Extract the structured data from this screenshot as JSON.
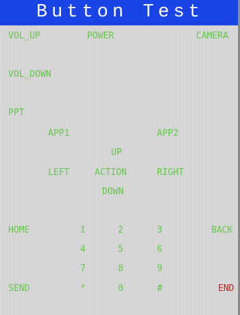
{
  "title": "Button Test",
  "colors": {
    "title_bar": "#1a44e6",
    "title_text": "#ffffff",
    "label": "#64c84a",
    "end_label": "#c81e1e",
    "screen": "#d9d9d9"
  },
  "buttons": {
    "vol_up": "VOL_UP",
    "power": "POWER",
    "camera": "CAMERA",
    "vol_down": "VOL_DOWN",
    "ppt": "PPT",
    "app1": "APP1",
    "app2": "APP2",
    "up": "UP",
    "left": "LEFT",
    "action": "ACTION",
    "right": "RIGHT",
    "down": "DOWN",
    "home": "HOME",
    "back": "BACK",
    "send": "SEND",
    "end": "END",
    "keypad": [
      "1",
      "2",
      "3",
      "4",
      "5",
      "6",
      "7",
      "8",
      "9",
      "*",
      "0",
      "#"
    ]
  }
}
